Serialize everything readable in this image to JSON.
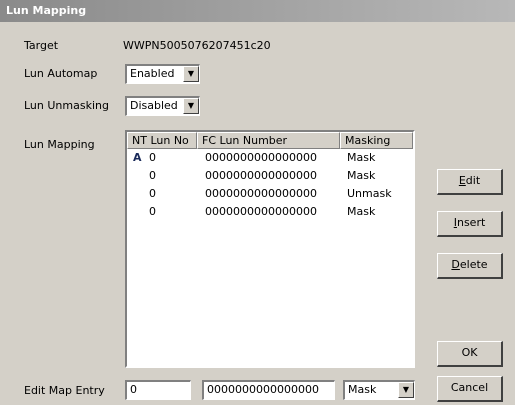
{
  "window": {
    "title": "Lun Mapping"
  },
  "target": {
    "label": "Target",
    "value": "WWPN5005076207451c20"
  },
  "lun_automap": {
    "label": "Lun Automap",
    "value": "Enabled"
  },
  "lun_unmasking": {
    "label": "Lun Unmasking",
    "value": "Disabled"
  },
  "lun_mapping": {
    "label": "Lun Mapping",
    "columns": [
      "NT Lun No",
      "FC Lun Number",
      "Masking"
    ],
    "rows": [
      {
        "nt_lun": "0",
        "fc_lun": "0000000000000000",
        "masking": "Mask",
        "selected_marker": "A"
      },
      {
        "nt_lun": "0",
        "fc_lun": "0000000000000000",
        "masking": "Mask",
        "selected_marker": ""
      },
      {
        "nt_lun": "0",
        "fc_lun": "0000000000000000",
        "masking": "Unmask",
        "selected_marker": ""
      },
      {
        "nt_lun": "0",
        "fc_lun": "0000000000000000",
        "masking": "Mask",
        "selected_marker": ""
      }
    ]
  },
  "buttons": {
    "edit_first": "E",
    "edit_rest": "dit",
    "insert_first": "I",
    "insert_rest": "nsert",
    "delete_first": "D",
    "delete_rest": "elete",
    "ok": "OK",
    "cancel": "Cancel"
  },
  "edit_map_entry": {
    "label": "Edit Map Entry",
    "nt_lun": "0",
    "fc_lun": "0000000000000000",
    "masking": "Mask"
  }
}
